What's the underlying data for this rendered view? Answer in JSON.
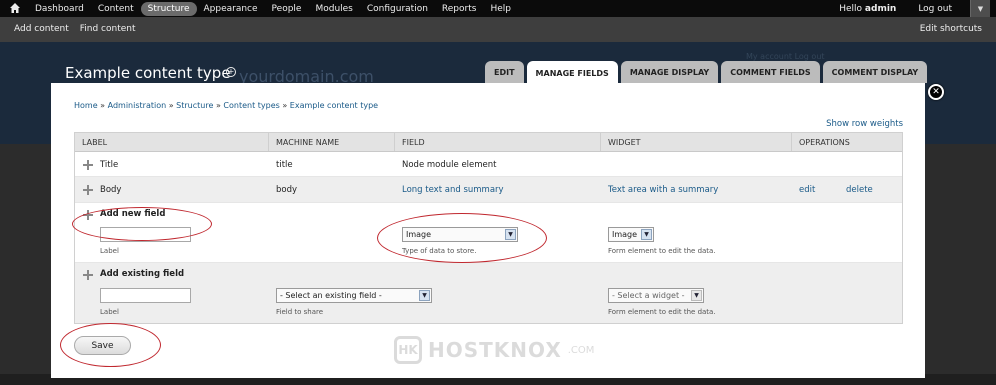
{
  "toolbar": {
    "menu": [
      "Dashboard",
      "Content",
      "Structure",
      "Appearance",
      "People",
      "Modules",
      "Configuration",
      "Reports",
      "Help"
    ],
    "active": "Structure",
    "hello_prefix": "Hello",
    "user": "admin",
    "logout": "Log out"
  },
  "shortcuts": {
    "add_content": "Add content",
    "find_content": "Find content",
    "edit_shortcuts": "Edit shortcuts"
  },
  "header": {
    "title": "Example content type",
    "ghost_domain": "yourdomain.com",
    "ghost_account": "My account     Log out"
  },
  "tabs": [
    "EDIT",
    "MANAGE FIELDS",
    "MANAGE DISPLAY",
    "COMMENT FIELDS",
    "COMMENT DISPLAY"
  ],
  "active_tab": "MANAGE FIELDS",
  "breadcrumb": [
    "Home",
    "Administration",
    "Structure",
    "Content types",
    "Example content type"
  ],
  "breadcrumb_sep": "»",
  "show_row_weights": "Show row weights",
  "table": {
    "headers": [
      "LABEL",
      "MACHINE NAME",
      "FIELD",
      "WIDGET",
      "OPERATIONS"
    ],
    "rows": [
      {
        "label": "Title",
        "machine": "title",
        "field": "Node module element",
        "widget": "",
        "ops": []
      },
      {
        "label": "Body",
        "machine": "body",
        "field": "Long text and summary",
        "widget": "Text area with a summary",
        "ops": [
          "edit",
          "delete"
        ]
      }
    ],
    "add_new": {
      "title": "Add new field",
      "label_desc": "Label",
      "field_value": "Image",
      "field_desc": "Type of data to store.",
      "widget_value": "Image",
      "widget_desc": "Form element to edit the data."
    },
    "add_existing": {
      "title": "Add existing field",
      "label_desc": "Label",
      "field_value": "- Select an existing field -",
      "field_desc": "Field to share",
      "widget_value": "- Select a widget -",
      "widget_desc": "Form element to edit the data."
    }
  },
  "save": "Save",
  "watermark": {
    "logo": "HK",
    "name": "HOSTKNOX",
    "tld": ".COM"
  },
  "colors": {
    "link": "#1a5a88",
    "highlight": "#c0282f",
    "toolbar": "#0b0b0b"
  }
}
